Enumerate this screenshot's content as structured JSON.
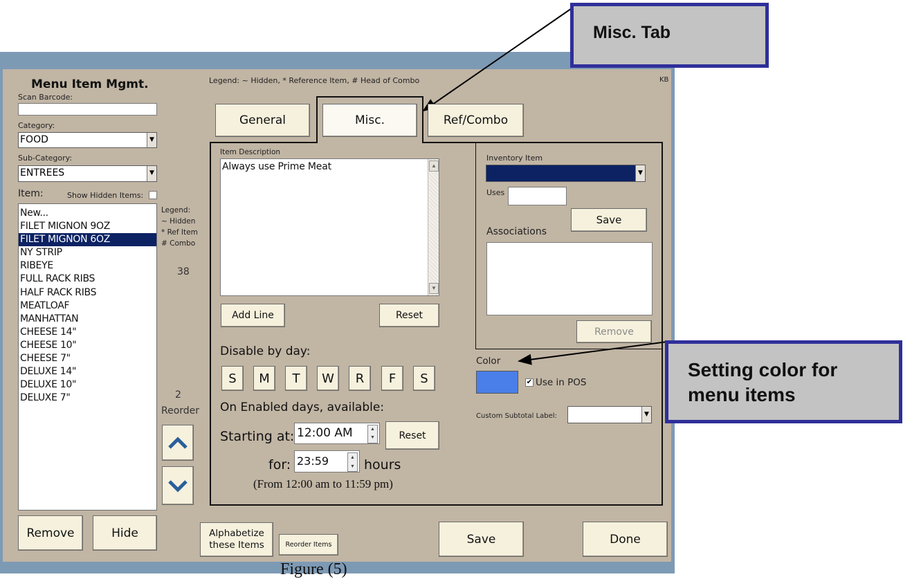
{
  "callouts": {
    "misc_tab": "Misc. Tab",
    "color_line1": "Setting color for",
    "color_line2": "menu items"
  },
  "header": {
    "title": "Menu Item Mgmt.",
    "legend_line": "Legend: ~ Hidden, * Reference Item, # Head of Combo",
    "user_initials": "KB"
  },
  "left": {
    "scan_label": "Scan Barcode:",
    "scan_value": "",
    "category_label": "Category:",
    "category_value": "FOOD",
    "subcategory_label": "Sub-Category:",
    "subcategory_value": "ENTREES",
    "item_label": "Item:",
    "show_hidden_label": "Show Hidden Items:",
    "show_hidden_checked": false,
    "items": [
      "New...",
      "FILET MIGNON 9OZ",
      "FILET MIGNON 6OZ",
      "NY STRIP",
      "RIBEYE",
      "FULL RACK RIBS",
      "HALF RACK RIBS",
      "MEATLOAF",
      "MANHATTAN",
      "CHEESE 14\"",
      "CHEESE 10\"",
      "CHEESE 7\"",
      "DELUXE 14\"",
      "DELUXE 10\"",
      "DELUXE 7\""
    ],
    "selected_item": "FILET MIGNON 6OZ",
    "legend_title": "Legend:",
    "legend_hidden": "~ Hidden",
    "legend_ref": "* Ref Item",
    "legend_combo": "# Combo",
    "item_count": "38",
    "reorder_position": "2",
    "reorder_label": "Reorder",
    "remove_label": "Remove",
    "hide_label": "Hide"
  },
  "tabs": {
    "general": "General",
    "misc": "Misc.",
    "refcombo": "Ref/Combo",
    "active": "Misc."
  },
  "misc": {
    "desc_label": "Item Description",
    "desc_value": "Always use Prime Meat",
    "add_line_label": "Add Line",
    "reset_label": "Reset",
    "disable_label": "Disable by day:",
    "days": [
      "S",
      "M",
      "T",
      "W",
      "R",
      "F",
      "S"
    ],
    "enabled_label": "On Enabled days, available:",
    "starting_label": "Starting at:",
    "start_time": "12:00 AM",
    "time_reset_label": "Reset",
    "for_label": "for:",
    "duration": "23:59",
    "hours_label": "hours",
    "range_text": "(From 12:00 am to 11:59 pm)",
    "inventory_label": "Inventory Item",
    "uses_label": "Uses",
    "uses_value": "",
    "save_label": "Save",
    "associations_label": "Associations",
    "remove_label": "Remove",
    "color_label": "Color",
    "color_value": "#4a7ee8",
    "use_in_pos_label": "Use in POS",
    "use_in_pos_checked": true,
    "subtotal_label": "Custom Subtotal Label:",
    "subtotal_value": ""
  },
  "bottom": {
    "alphabetize_line1": "Alphabetize",
    "alphabetize_line2": "these Items",
    "reorder_items_label": "Reorder Items",
    "save_label": "Save",
    "done_label": "Done"
  },
  "caption": "Figure (5)"
}
